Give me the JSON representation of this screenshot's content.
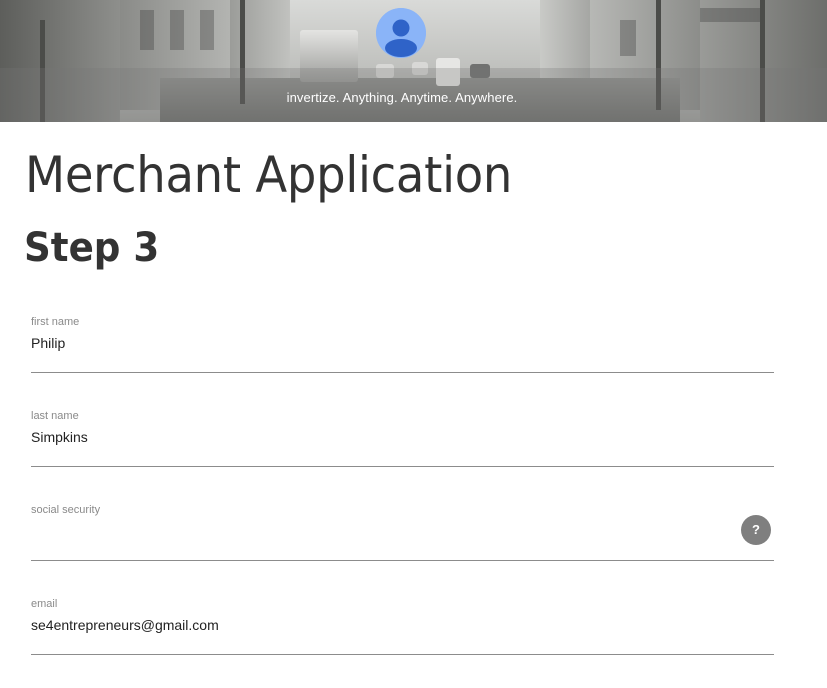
{
  "header": {
    "tagline": "invertize. Anything. Anytime. Anywhere.",
    "avatar_icon": "user-avatar-icon",
    "avatar_color": "#8ab4f8"
  },
  "page": {
    "title": "Merchant Application",
    "step": "Step 3"
  },
  "form": {
    "first_name": {
      "label": "first name",
      "value": "Philip"
    },
    "last_name": {
      "label": "last name",
      "value": "Simpkins"
    },
    "social_security": {
      "label": "social security",
      "value": "",
      "help_label": "?"
    },
    "email": {
      "label": "email",
      "value": "se4entrepreneurs@gmail.com"
    }
  }
}
